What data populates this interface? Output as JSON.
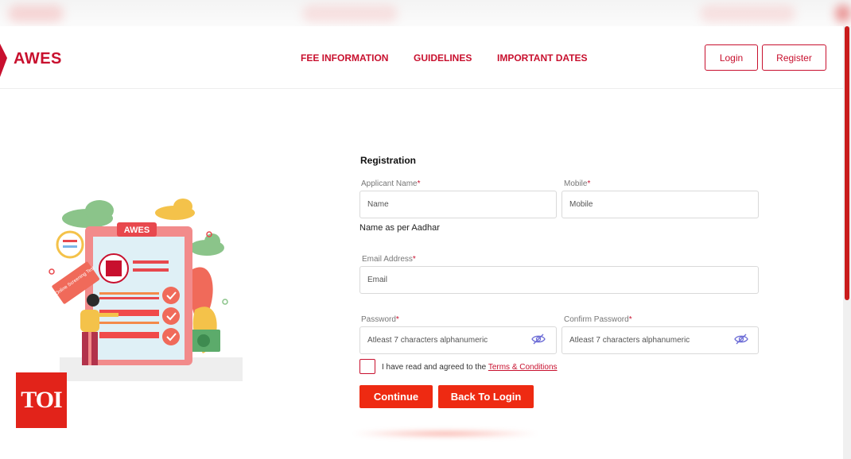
{
  "header": {
    "brand": "AWES",
    "nav": [
      {
        "label": "FEE INFORMATION"
      },
      {
        "label": "GUIDELINES"
      },
      {
        "label": "IMPORTANT DATES"
      }
    ],
    "login_label": "Login",
    "register_label": "Register"
  },
  "illustration": {
    "board_label": "AWES",
    "tag_text": "Online Screening Test"
  },
  "form": {
    "title": "Registration",
    "applicant_name": {
      "label": "Applicant Name",
      "required": "*",
      "placeholder": "Name",
      "hint": "Name as per Aadhar"
    },
    "mobile": {
      "label": "Mobile",
      "required": "*",
      "placeholder": "Mobile"
    },
    "email": {
      "label": "Email Address",
      "required": "*",
      "placeholder": "Email"
    },
    "password": {
      "label": "Password",
      "required": "*",
      "placeholder": "Atleast 7 characters alphanumeric"
    },
    "confirm_password": {
      "label": "Confirm Password",
      "required": "*",
      "placeholder": "Atleast 7 characters alphanumeric"
    },
    "agree_text": "I have read and agreed to the",
    "terms_link": "Terms & Conditions",
    "continue_label": "Continue",
    "back_label": "Back To Login"
  },
  "watermark": {
    "text": "TOI"
  },
  "colors": {
    "accent": "#c8102e",
    "button": "#ee2a12"
  },
  "icons": [
    "eye-slash-icon",
    "awes-logo-icon"
  ]
}
